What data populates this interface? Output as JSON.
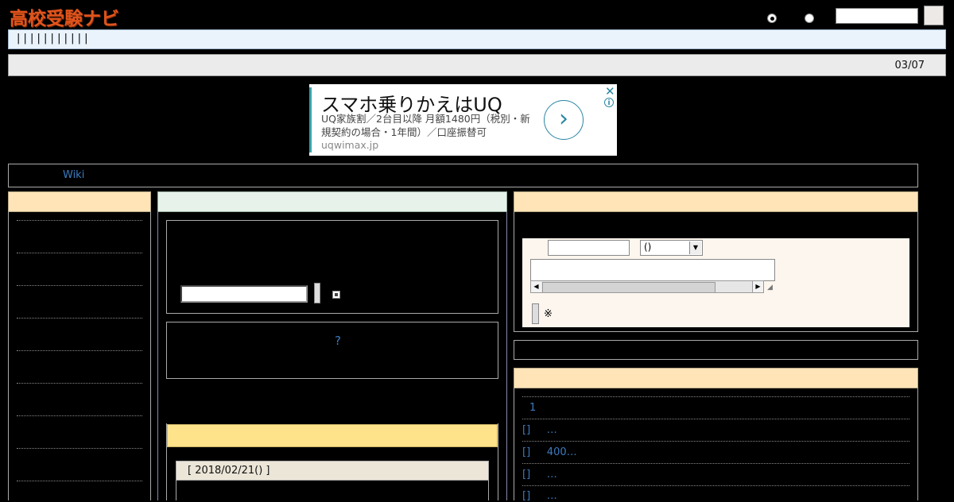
{
  "header": {
    "logo": "高校受験ナビ",
    "search_placeholder": "",
    "search_button": ""
  },
  "nav": {
    "text": "| | | | | | | | | | |"
  },
  "date_bar": {
    "date": "03/07"
  },
  "ad": {
    "headline": "スマホ乗りかえはUQ",
    "body": "UQ家族割／2台目以降 月額1480円（税別・新規契約の場合・1年間）／口座振替可",
    "url": "uqwimax.jp",
    "arrow": "›",
    "close": "✕",
    "info": "i"
  },
  "breadcrumb": {
    "link": "Wiki"
  },
  "center": {
    "question_link": "?",
    "news_date": "[ 2018/02/21() ]"
  },
  "form": {
    "select_value": "()",
    "select_arrow": "▼",
    "scroll_left": "◀",
    "scroll_right": "▶",
    "resize": "◢",
    "note": "※"
  },
  "right_list": [
    {
      "label": "1"
    },
    {
      "label": "[]     …"
    },
    {
      "label": "[]     400…"
    },
    {
      "label": "[]     …"
    },
    {
      "label": "[]     …"
    }
  ]
}
